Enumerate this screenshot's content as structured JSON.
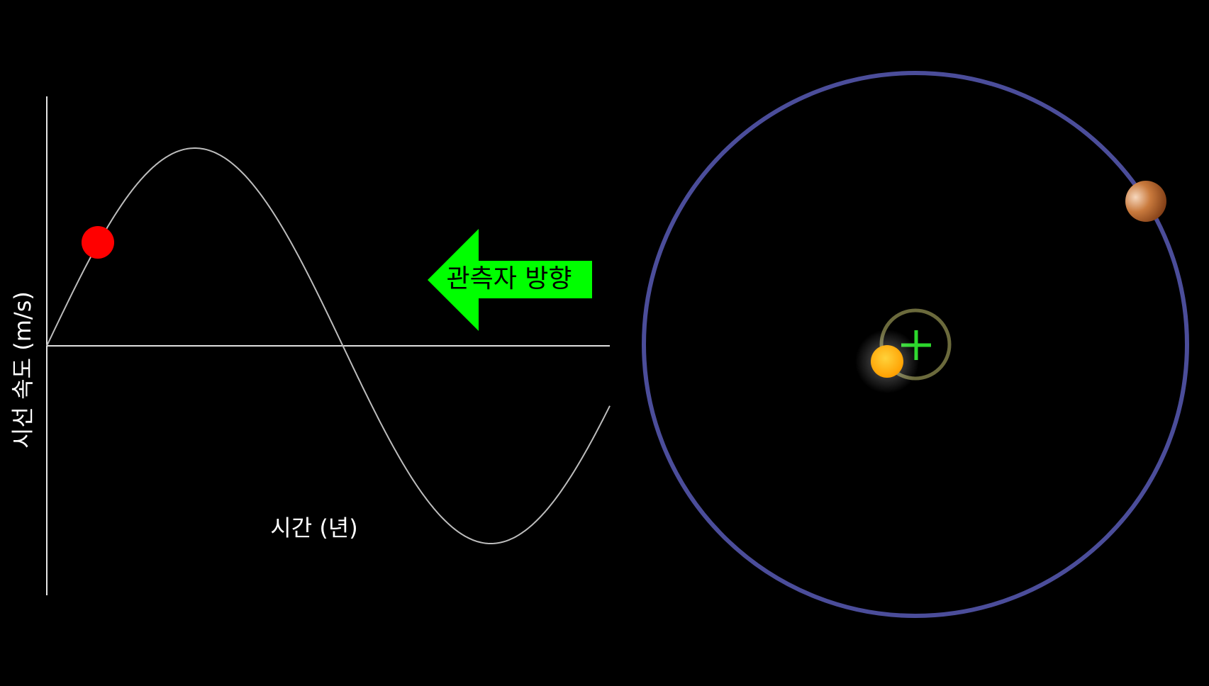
{
  "graph": {
    "y_axis_label": "시선 속도 (m/s)",
    "x_axis_label": "시간 (년)"
  },
  "observer_arrow": {
    "label": "관측자 방향",
    "color": "#00ff00"
  },
  "colors": {
    "background": "#000000",
    "axes": "#ffffff",
    "curve": "#bdbdbd",
    "marker": "#ff0000",
    "planet_orbit": "#4b4d9a",
    "star_orbit": "#6b6a3c",
    "barycenter": "#2cd72c",
    "star": "#ffb300",
    "planet": "#b5612a"
  },
  "icons": {
    "barycenter": "plus-icon",
    "star": "sun-icon",
    "planet": "planet-icon"
  }
}
